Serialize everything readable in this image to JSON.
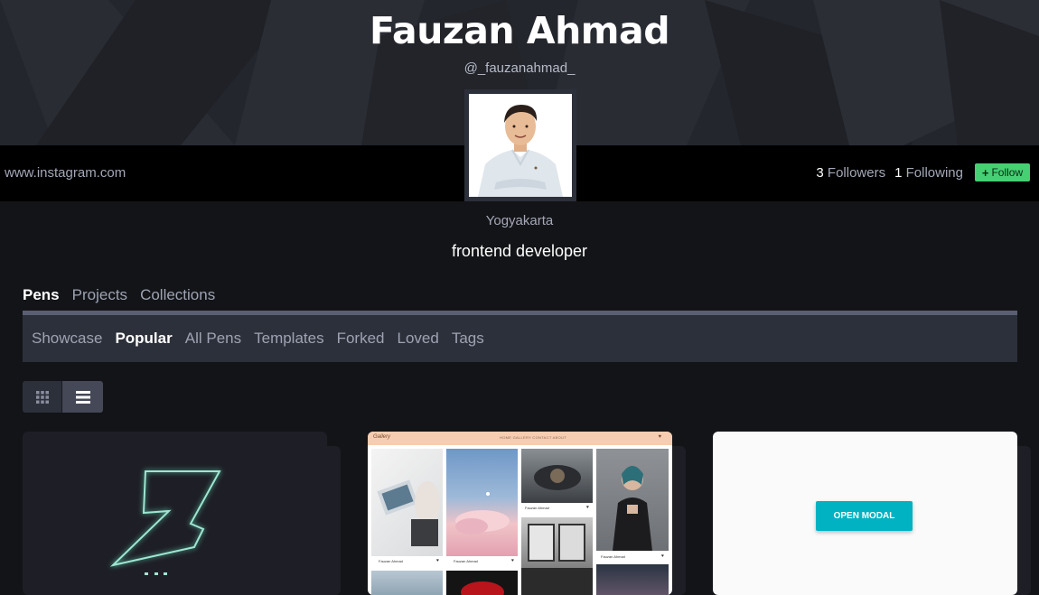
{
  "profile": {
    "name": "Fauzan Ahmad",
    "handle": "@_fauzanahmad_",
    "website": "www.instagram.com",
    "location": "Yogyakarta",
    "bio": "frontend developer",
    "followers_count": "3",
    "followers_label": "Followers",
    "following_count": "1",
    "following_label": "Following",
    "follow_label": "Follow"
  },
  "tabs": [
    {
      "label": "Pens",
      "active": true
    },
    {
      "label": "Projects",
      "active": false
    },
    {
      "label": "Collections",
      "active": false
    }
  ],
  "subnav": [
    {
      "label": "Showcase",
      "active": false
    },
    {
      "label": "Popular",
      "active": true
    },
    {
      "label": "All Pens",
      "active": false
    },
    {
      "label": "Templates",
      "active": false
    },
    {
      "label": "Forked",
      "active": false
    },
    {
      "label": "Loved",
      "active": false
    },
    {
      "label": "Tags",
      "active": false
    }
  ],
  "view_toggle": {
    "selected": "list",
    "icons": [
      "grid-icon",
      "list-icon"
    ]
  },
  "cards": [
    {
      "preview": "neon-z-logo"
    },
    {
      "preview": "gallery",
      "gallery": {
        "logo": "Gallery",
        "nav": "HOME  GALLERY  CONTACT  ABOUT",
        "captions": [
          "Fauzan Ahmad",
          "Fauzan Ahmad",
          "Fauzan Ahmad",
          "Fauzan Ahmad"
        ]
      }
    },
    {
      "preview": "modal",
      "button_label": "OPEN MODAL"
    }
  ],
  "colors": {
    "accent_green": "#47cf73",
    "modal_cyan": "#00b2c2",
    "hero_bg": "#24262d"
  }
}
